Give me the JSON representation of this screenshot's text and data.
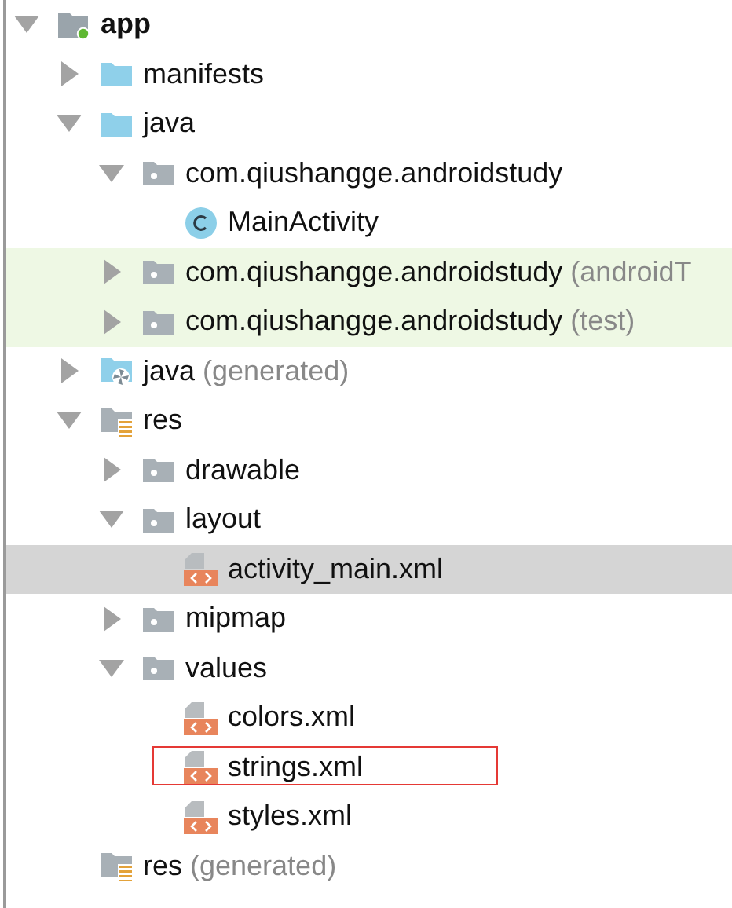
{
  "project_tree": [
    {
      "label": "app",
      "kind": "module",
      "expanded": true,
      "children": [
        {
          "label": "manifests",
          "kind": "folder",
          "expanded": false
        },
        {
          "label": "java",
          "kind": "folder",
          "expanded": true,
          "children": [
            {
              "label": "com.qiushangge.androidstudy",
              "kind": "package",
              "expanded": true,
              "children": [
                {
                  "label": "MainActivity",
                  "kind": "class"
                }
              ]
            },
            {
              "label": "com.qiushangge.androidstudy",
              "note": "(androidT",
              "kind": "package",
              "expanded": false,
              "test_source": true
            },
            {
              "label": "com.qiushangge.androidstudy",
              "note": "(test)",
              "kind": "package",
              "expanded": false,
              "test_source": true
            }
          ]
        },
        {
          "label": "java",
          "note": "(generated)",
          "kind": "generated",
          "expanded": false
        },
        {
          "label": "res",
          "kind": "res",
          "expanded": true,
          "children": [
            {
              "label": "drawable",
              "kind": "package",
              "expanded": false
            },
            {
              "label": "layout",
              "kind": "package",
              "expanded": true,
              "children": [
                {
                  "label": "activity_main.xml",
                  "kind": "xml",
                  "selected": true
                }
              ]
            },
            {
              "label": "mipmap",
              "kind": "package",
              "expanded": false
            },
            {
              "label": "values",
              "kind": "package",
              "expanded": true,
              "children": [
                {
                  "label": "colors.xml",
                  "kind": "xml",
                  "selected": false
                },
                {
                  "label": "strings.xml",
                  "kind": "xml",
                  "selected": false,
                  "marked": true
                },
                {
                  "label": "styles.xml",
                  "kind": "xml",
                  "selected": false
                }
              ]
            }
          ]
        },
        {
          "label": "res",
          "note": "(generated)",
          "kind": "res"
        }
      ]
    }
  ]
}
